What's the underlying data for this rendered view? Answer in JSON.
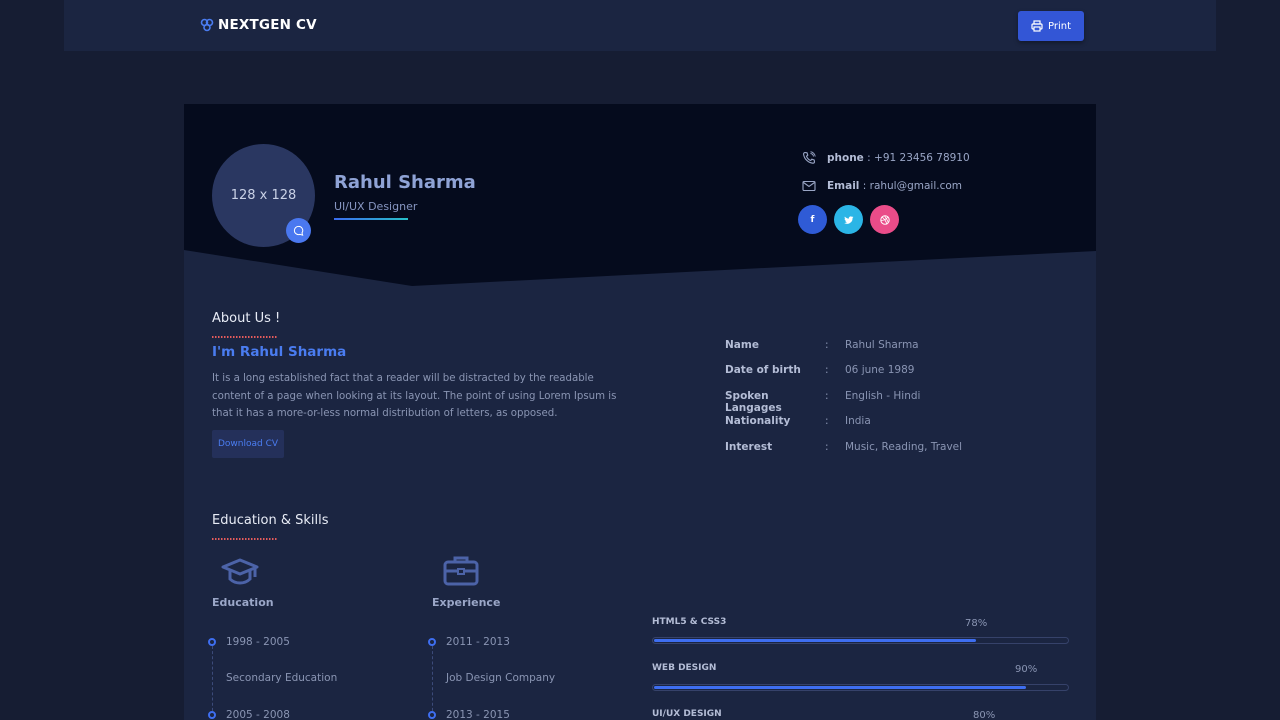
{
  "nav": {
    "brand": "NEXTGEN CV",
    "print_label": "Print"
  },
  "profile": {
    "avatar_placeholder": "128 x 128",
    "name": "Rahul Sharma",
    "role": "UI/UX Designer",
    "phone_label": "phone",
    "phone": ": +91 23456 78910",
    "email_label": "Email",
    "email": ": rahul@gmail.com",
    "socials": [
      {
        "icon": "facebook-icon",
        "glyph": "f",
        "color": "#2f5bd6"
      },
      {
        "icon": "twitter-icon",
        "glyph": "t",
        "color": "#2bb5e6"
      },
      {
        "icon": "dribbble-icon",
        "glyph": "◎",
        "color": "#ea4c89"
      }
    ]
  },
  "about": {
    "title": "About Us !",
    "hello": "I'm Rahul Sharma",
    "text": "It is a long established fact that a reader will be distracted by the readable content of a page when looking at its layout. The point of using Lorem Ipsum is that it has a more-or-less normal distribution of letters, as opposed.",
    "download_label": "Download CV",
    "info": [
      {
        "label": "Name",
        "sep": ":",
        "value": "Rahul Sharma"
      },
      {
        "label": "Date of birth",
        "sep": ":",
        "value": "06 june 1989"
      },
      {
        "label": "Spoken Langages",
        "sep": ":",
        "value": "English - Hindi"
      },
      {
        "label": "Nationality",
        "sep": ":",
        "value": "India"
      },
      {
        "label": "Interest",
        "sep": ":",
        "value": "Music, Reading, Travel"
      }
    ]
  },
  "education_skills": {
    "title": "Education & Skills",
    "education": {
      "title": "Education",
      "icon": "graduation-cap-icon",
      "items": [
        {
          "period": "1998 - 2005",
          "desc": "Secondary Education"
        },
        {
          "period": "2005 - 2008",
          "desc": ""
        }
      ]
    },
    "experience": {
      "title": "Experience",
      "icon": "briefcase-icon",
      "items": [
        {
          "period": "2011 - 2013",
          "desc": "Job Design Company"
        },
        {
          "period": "2013 - 2015",
          "desc": ""
        }
      ]
    },
    "skills": [
      {
        "name": "HTML5 & CSS3",
        "percent_label": "78%",
        "value": 0.78
      },
      {
        "name": "WEB DESIGN",
        "percent_label": "90%",
        "value": 0.9
      },
      {
        "name": "UI/UX DESIGN",
        "percent_label": "80%",
        "value": 0.8
      }
    ]
  },
  "colors": {
    "accent": "#3e6ef0",
    "card": "#1b2541",
    "hero": "#050b1d",
    "background": "#161d33"
  }
}
